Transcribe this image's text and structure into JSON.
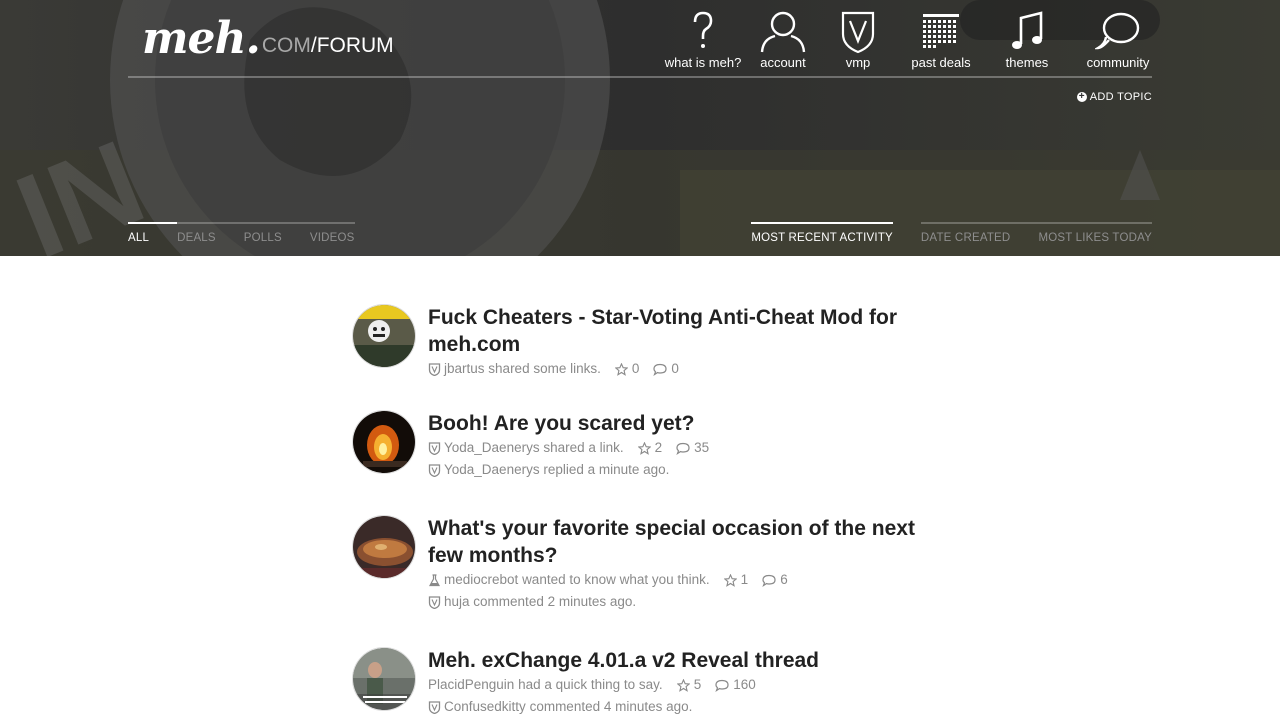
{
  "logo": {
    "meh": "meh.",
    "com": "COM",
    "forum": "/FORUM"
  },
  "nav": [
    {
      "label": "what is meh?",
      "icon": "question-icon"
    },
    {
      "label": "account",
      "icon": "person-icon"
    },
    {
      "label": "vmp",
      "icon": "vmp-shield-icon"
    },
    {
      "label": "past deals",
      "icon": "calendar-grid-icon"
    },
    {
      "label": "themes",
      "icon": "music-note-icon"
    },
    {
      "label": "community",
      "icon": "chat-bubbles-icon"
    }
  ],
  "add_topic": "ADD TOPIC",
  "filter_tabs": [
    "ALL",
    "DEALS",
    "POLLS",
    "VIDEOS"
  ],
  "sort_tabs": [
    "MOST RECENT ACTIVITY",
    "DATE CREATED",
    "MOST LIKES TODAY"
  ],
  "active_filter": "ALL",
  "active_sort": "MOST RECENT ACTIVITY",
  "colors": {
    "text": "#222222",
    "meta": "#8a8a8a",
    "hero_bg": "#333333"
  },
  "topics": [
    {
      "title": "Fuck Cheaters - Star-Voting Anti-Cheat Mod for meh.com",
      "author": "jbartus",
      "action": "shared some links.",
      "author_icon": "vmp-shield-icon",
      "likes": "0",
      "comments": "0",
      "reply": null
    },
    {
      "title": "Booh! Are you scared yet?",
      "author": "Yoda_Daenerys",
      "action": "shared a link.",
      "author_icon": "vmp-shield-icon",
      "likes": "2",
      "comments": "35",
      "reply": {
        "user": "Yoda_Daenerys",
        "action": "replied a minute ago.",
        "icon": "vmp-shield-icon"
      }
    },
    {
      "title": "What's your favorite special occasion of the next few months?",
      "author": "mediocrebot",
      "action": "wanted to know what you think.",
      "author_icon": "flask-icon",
      "likes": "1",
      "comments": "6",
      "reply": {
        "user": "huja",
        "action": "commented 2 minutes ago.",
        "icon": "vmp-shield-icon"
      }
    },
    {
      "title": "Meh. exChange 4.01.a v2 Reveal thread",
      "author": "PlacidPenguin",
      "action": "had a quick thing to say.",
      "author_icon": "",
      "likes": "5",
      "comments": "160",
      "reply": {
        "user": "Confusedkitty",
        "action": "commented 4 minutes ago.",
        "icon": "vmp-shield-icon"
      }
    }
  ]
}
